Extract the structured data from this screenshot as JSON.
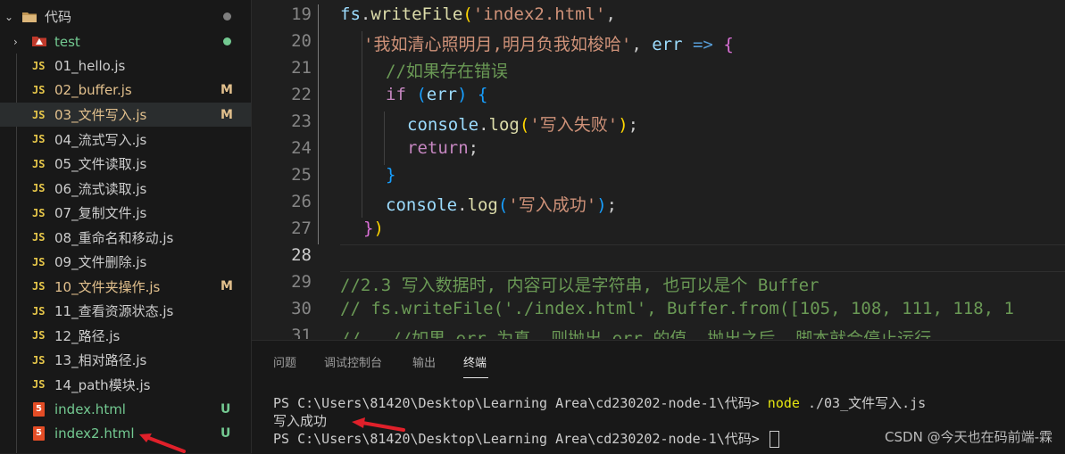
{
  "explorer": {
    "root_folder": "代码",
    "test_folder": "test",
    "files": [
      {
        "name": "01_hello.js",
        "type": "js",
        "git": ""
      },
      {
        "name": "02_buffer.js",
        "type": "js",
        "git": "M"
      },
      {
        "name": "03_文件写入.js",
        "type": "js",
        "git": "M"
      },
      {
        "name": "04_流式写入.js",
        "type": "js",
        "git": ""
      },
      {
        "name": "05_文件读取.js",
        "type": "js",
        "git": ""
      },
      {
        "name": "06_流式读取.js",
        "type": "js",
        "git": ""
      },
      {
        "name": "07_复制文件.js",
        "type": "js",
        "git": ""
      },
      {
        "name": "08_重命名和移动.js",
        "type": "js",
        "git": ""
      },
      {
        "name": "09_文件删除.js",
        "type": "js",
        "git": ""
      },
      {
        "name": "10_文件夹操作.js",
        "type": "js",
        "git": "M"
      },
      {
        "name": "11_查看资源状态.js",
        "type": "js",
        "git": ""
      },
      {
        "name": "12_路径.js",
        "type": "js",
        "git": ""
      },
      {
        "name": "13_相对路径.js",
        "type": "js",
        "git": ""
      },
      {
        "name": "14_path模块.js",
        "type": "js",
        "git": ""
      },
      {
        "name": "index.html",
        "type": "html",
        "git": "U"
      },
      {
        "name": "index2.html",
        "type": "html",
        "git": "U"
      }
    ],
    "js_icon_text": "JS",
    "html_icon_text": "5"
  },
  "editor": {
    "line_numbers": [
      "19",
      "20",
      "21",
      "22",
      "23",
      "24",
      "25",
      "26",
      "27",
      "28",
      "29",
      "30",
      "31"
    ],
    "line19": {
      "a": "fs",
      "b": ".",
      "c": "writeFile",
      "d": "(",
      "e": "'index2.html'",
      "f": ","
    },
    "line20": {
      "a": "'我如清心照明月,明月负我如梭哈'",
      "b": ", ",
      "c": "err",
      "d": " => ",
      "e": "{"
    },
    "line21": {
      "a": "//如果存在错误"
    },
    "line22": {
      "a": "if",
      "b": " ",
      "c": "(",
      "d": "err",
      "e": ")",
      "f": " ",
      "g": "{"
    },
    "line23": {
      "a": "console",
      "b": ".",
      "c": "log",
      "d": "(",
      "e": "'写入失败'",
      "f": ")",
      "g": ";"
    },
    "line24": {
      "a": "return",
      "b": ";"
    },
    "line25": {
      "a": "}"
    },
    "line26": {
      "a": "console",
      "b": ".",
      "c": "log",
      "d": "(",
      "e": "'写入成功'",
      "f": ")",
      "g": ";"
    },
    "line27": {
      "a": "}",
      "b": ")"
    },
    "line29": {
      "a": "//2.3 写入数据时, 内容可以是字符串, 也可以是个 Buffer"
    },
    "line30": {
      "a": "// fs.writeFile('./index.html', Buffer.from([105, 108, 111, 118, 1"
    },
    "line31": {
      "a": "//   //如果 err 为真, 则抛出 err 的值, 抛出之后, 脚本就会停止运行"
    }
  },
  "panel": {
    "tabs": [
      "问题",
      "调试控制台",
      "输出",
      "终端"
    ],
    "active_tab": "终端",
    "terminal": {
      "line1_prompt": "PS C:\\Users\\81420\\Desktop\\Learning Area\\cd230202-node-1\\代码> ",
      "line1_cmd": "node",
      "line1_arg": " ./03_文件写入.js",
      "line2": "写入成功",
      "line3_prompt": "PS C:\\Users\\81420\\Desktop\\Learning Area\\cd230202-node-1\\代码> "
    }
  },
  "watermark": "CSDN @今天也在码前端-霖",
  "colors": {
    "accent_arrow": "#e0202a",
    "git_modified": "#e2c08d",
    "git_untracked": "#73c991"
  }
}
